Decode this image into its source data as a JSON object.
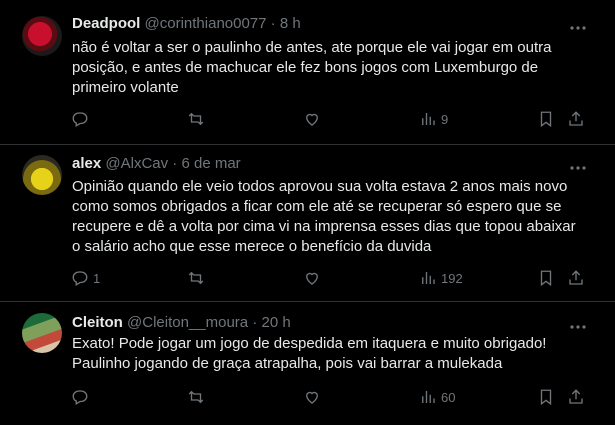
{
  "tweets": [
    {
      "display_name": "Deadpool",
      "handle": "@corinthiano0077",
      "separator": "·",
      "time": "8 h",
      "text": "não é voltar a ser o paulinho de antes, ate porque ele vai jogar em outra posição, e antes de machucar ele fez bons jogos com Luxemburgo de primeiro volante",
      "replies": "",
      "views": "9"
    },
    {
      "display_name": "alex",
      "handle": "@AlxCav",
      "separator": "·",
      "time": "6 de mar",
      "text": "Opinião quando ele veio todos aprovou sua volta estava 2 anos mais novo como somos obrigados a ficar com ele até se recuperar só espero que se recupere e dê a volta por cima vi na imprensa esses dias que topou abaixar o salário acho que esse merece o benefício da duvida",
      "replies": "1",
      "views": "192"
    },
    {
      "display_name": "Cleiton",
      "handle": "@Cleiton__moura",
      "separator": "·",
      "time": "20 h",
      "text": "Exato! Pode jogar um jogo de despedida em itaquera e muito obrigado! Paulinho jogando de graça atrapalha, pois vai barrar a mulekada",
      "replies": "",
      "views": "60"
    }
  ],
  "icons": {
    "reply": "reply-icon",
    "retweet": "retweet-icon",
    "like": "like-icon",
    "views": "views-icon",
    "bookmark": "bookmark-icon",
    "share": "share-icon",
    "more": "more-icon"
  },
  "colors": {
    "background": "#000000",
    "text": "#e7e9ea",
    "muted": "#71767b",
    "divider": "#2f3336"
  }
}
